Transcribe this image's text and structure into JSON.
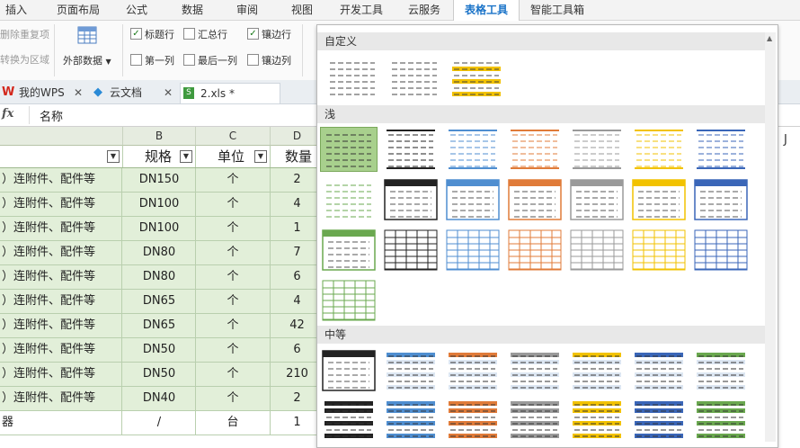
{
  "ribbon_tabs": [
    "插入",
    "页面布局",
    "公式",
    "数据",
    "审阅",
    "视图",
    "开发工具",
    "云服务",
    "表格工具",
    "智能工具箱"
  ],
  "active_tab": "表格工具",
  "ribbon": {
    "remove_dup": "删除重复项",
    "convert_range": "转换为区域",
    "external_data": "外部数据",
    "header_row": "标题行",
    "total_row": "汇总行",
    "banded_rows": "镶边行",
    "first_col": "第一列",
    "last_col": "最后一列",
    "banded_cols": "镶边列"
  },
  "doc_tabs": [
    {
      "label": "我的WPS"
    },
    {
      "label": "云文档"
    },
    {
      "label": "2.xls *"
    }
  ],
  "formula_bar": {
    "fx": "fx",
    "value": "名称"
  },
  "sheet": {
    "col_headers": [
      "B",
      "C",
      "D"
    ],
    "header_row": [
      "规格",
      "单位",
      "数量"
    ],
    "rows": [
      [
        "）连附件、配件等",
        "DN150",
        "个",
        "2"
      ],
      [
        "）连附件、配件等",
        "DN100",
        "个",
        "4"
      ],
      [
        "）连附件、配件等",
        "DN100",
        "个",
        "1"
      ],
      [
        "）连附件、配件等",
        "DN80",
        "个",
        "7"
      ],
      [
        "）连附件、配件等",
        "DN80",
        "个",
        "6"
      ],
      [
        "）连附件、配件等",
        "DN65",
        "个",
        "4"
      ],
      [
        "）连附件、配件等",
        "DN65",
        "个",
        "42"
      ],
      [
        "）连附件、配件等",
        "DN50",
        "个",
        "6"
      ],
      [
        "）连附件、配件等",
        "DN50",
        "个",
        "210"
      ],
      [
        "）连附件、配件等",
        "DN40",
        "个",
        "2"
      ],
      [
        "器",
        "/",
        "台",
        "1"
      ]
    ]
  },
  "gallery": {
    "section_custom": "自定义",
    "section_light": "浅",
    "section_medium": "中等",
    "col_j": "J",
    "colors": {
      "black": "#222222",
      "blue": "#4f8ed0",
      "orange": "#e07b39",
      "gray": "#9a9a9a",
      "gold": "#f2c200",
      "navy": "#3a66b8",
      "green": "#6aa84f"
    }
  }
}
